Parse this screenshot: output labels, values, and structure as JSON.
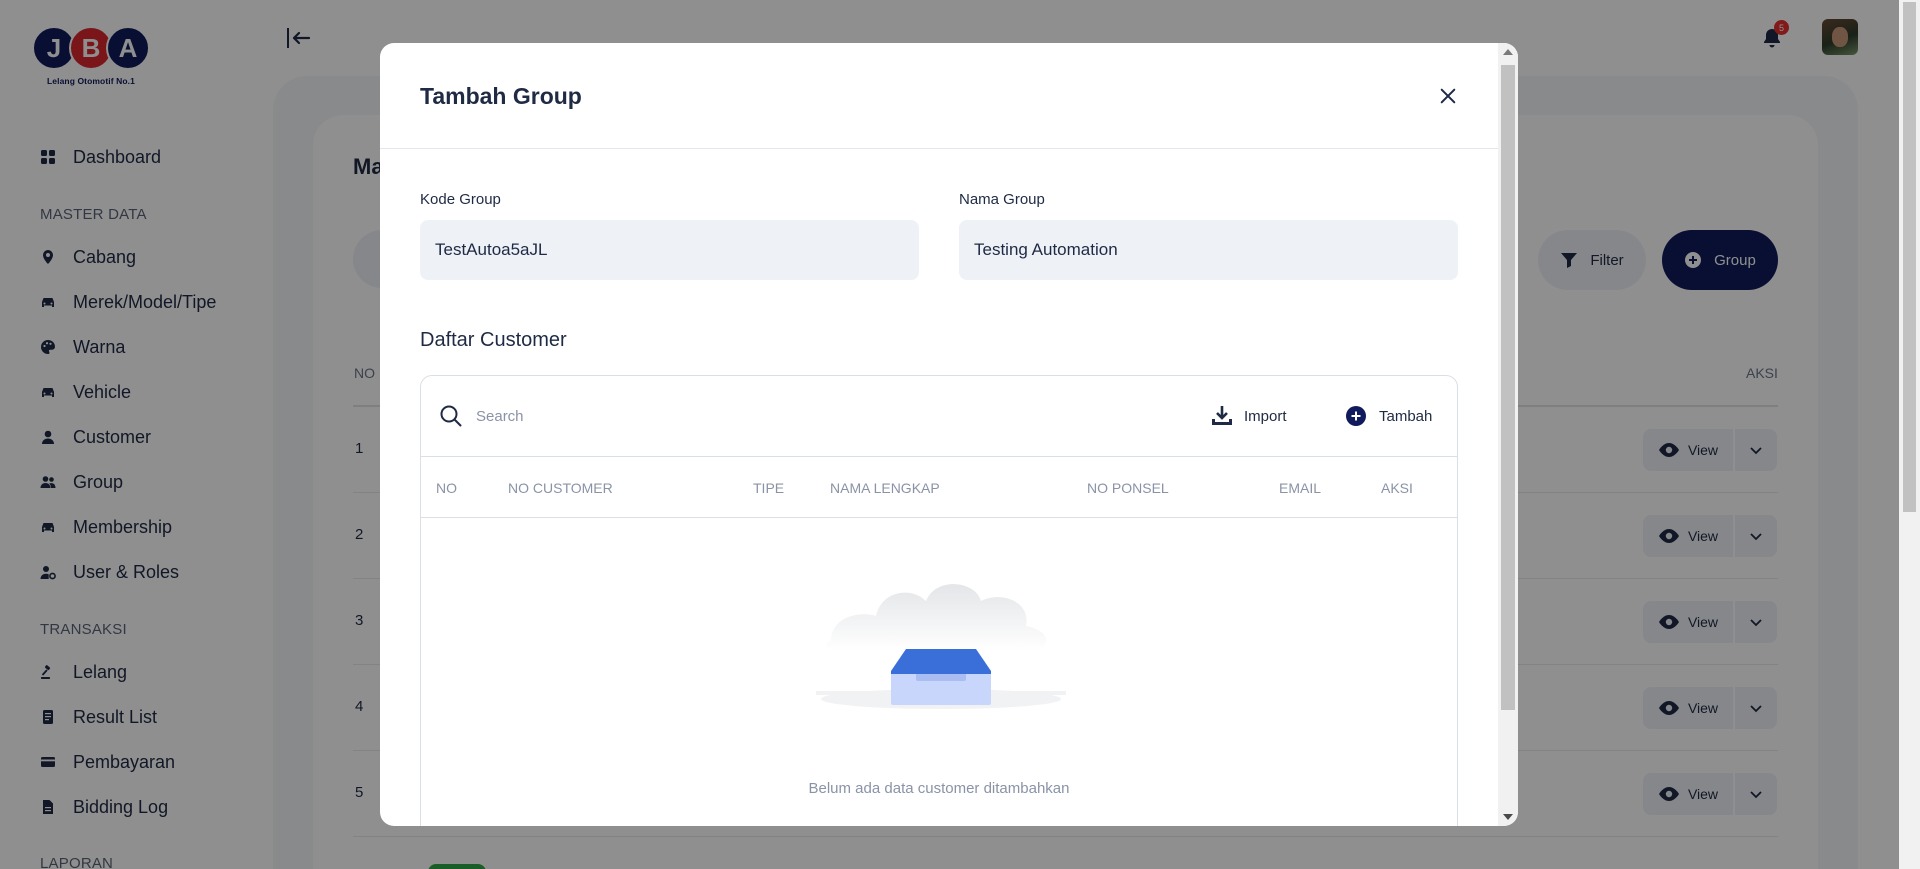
{
  "logo": {
    "letters": [
      "J",
      "B",
      "A"
    ],
    "tagline": "Lelang Otomotif No.1",
    "colors": {
      "navy": "#0f1b5c",
      "red": "#d9262e"
    }
  },
  "sidebar": {
    "items": [
      {
        "label": "Dashboard",
        "icon": "dashboard-icon"
      },
      {
        "label": "Cabang",
        "icon": "location-pin-icon"
      },
      {
        "label": "Merek/Model/Tipe",
        "icon": "car-icon"
      },
      {
        "label": "Warna",
        "icon": "palette-icon"
      },
      {
        "label": "Vehicle",
        "icon": "car-icon"
      },
      {
        "label": "Customer",
        "icon": "user-icon"
      },
      {
        "label": "Group",
        "icon": "users-icon",
        "active": true
      },
      {
        "label": "Membership",
        "icon": "car-icon"
      },
      {
        "label": "User & Roles",
        "icon": "user-cog-icon"
      },
      {
        "label": "Lelang",
        "icon": "gavel-icon"
      },
      {
        "label": "Result List",
        "icon": "document-icon"
      },
      {
        "label": "Pembayaran",
        "icon": "credit-card-icon"
      },
      {
        "label": "Bidding Log",
        "icon": "file-icon"
      }
    ],
    "sections": [
      "MASTER DATA",
      "TRANSAKSI",
      "LAPORAN"
    ]
  },
  "topbar": {
    "notification_count": "5"
  },
  "background_page": {
    "title": "Ma",
    "filter_label": "Filter",
    "group_button_label": "Group",
    "table_header_no": "NO",
    "table_header_aksi": "AKSI",
    "row_numbers": [
      "1",
      "2",
      "3",
      "4",
      "5"
    ],
    "view_label": "View"
  },
  "modal": {
    "title": "Tambah Group",
    "kode_label": "Kode Group",
    "kode_value": "TestAutoa5aJL",
    "nama_label": "Nama Group",
    "nama_value": "Testing Automation",
    "daftar_title": "Daftar Customer",
    "search_placeholder": "Search",
    "import_label": "Import",
    "tambah_label": "Tambah",
    "columns": [
      "NO",
      "NO CUSTOMER",
      "TIPE",
      "NAMA LENGKAP",
      "NO PONSEL",
      "EMAIL",
      "AKSI"
    ],
    "empty_message": "Belum ada data customer ditambahkan"
  },
  "colors": {
    "primary": "#0f1b5c",
    "text": "#1f2a44",
    "input_bg": "#eef1f6",
    "badge": "#e5302f",
    "muted": "#8a93a6"
  }
}
